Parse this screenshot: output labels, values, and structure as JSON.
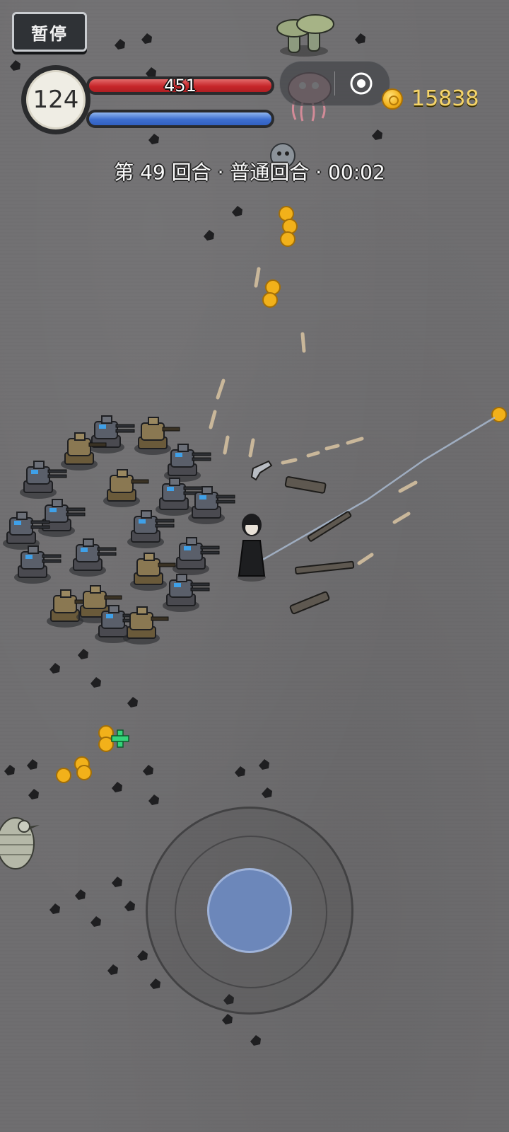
{
  "hud": {
    "pause_label": "暂停",
    "level": "124",
    "hp": {
      "value": "451",
      "fill_fraction": 1.0,
      "color": "#c7262a"
    },
    "mp": {
      "fill_fraction": 1.0,
      "color": "#3e6fd0"
    },
    "gold": "15838",
    "round_info": "第 49 回合 · 普通回合 · 00:02"
  },
  "controls": {
    "joystick_color": "#6c87ba"
  },
  "icons": {
    "pause": "pause-button",
    "gold": "gold-coin-icon",
    "more": "more-options-icon",
    "close": "target-circle-icon",
    "heal": "green-cross-icon"
  }
}
